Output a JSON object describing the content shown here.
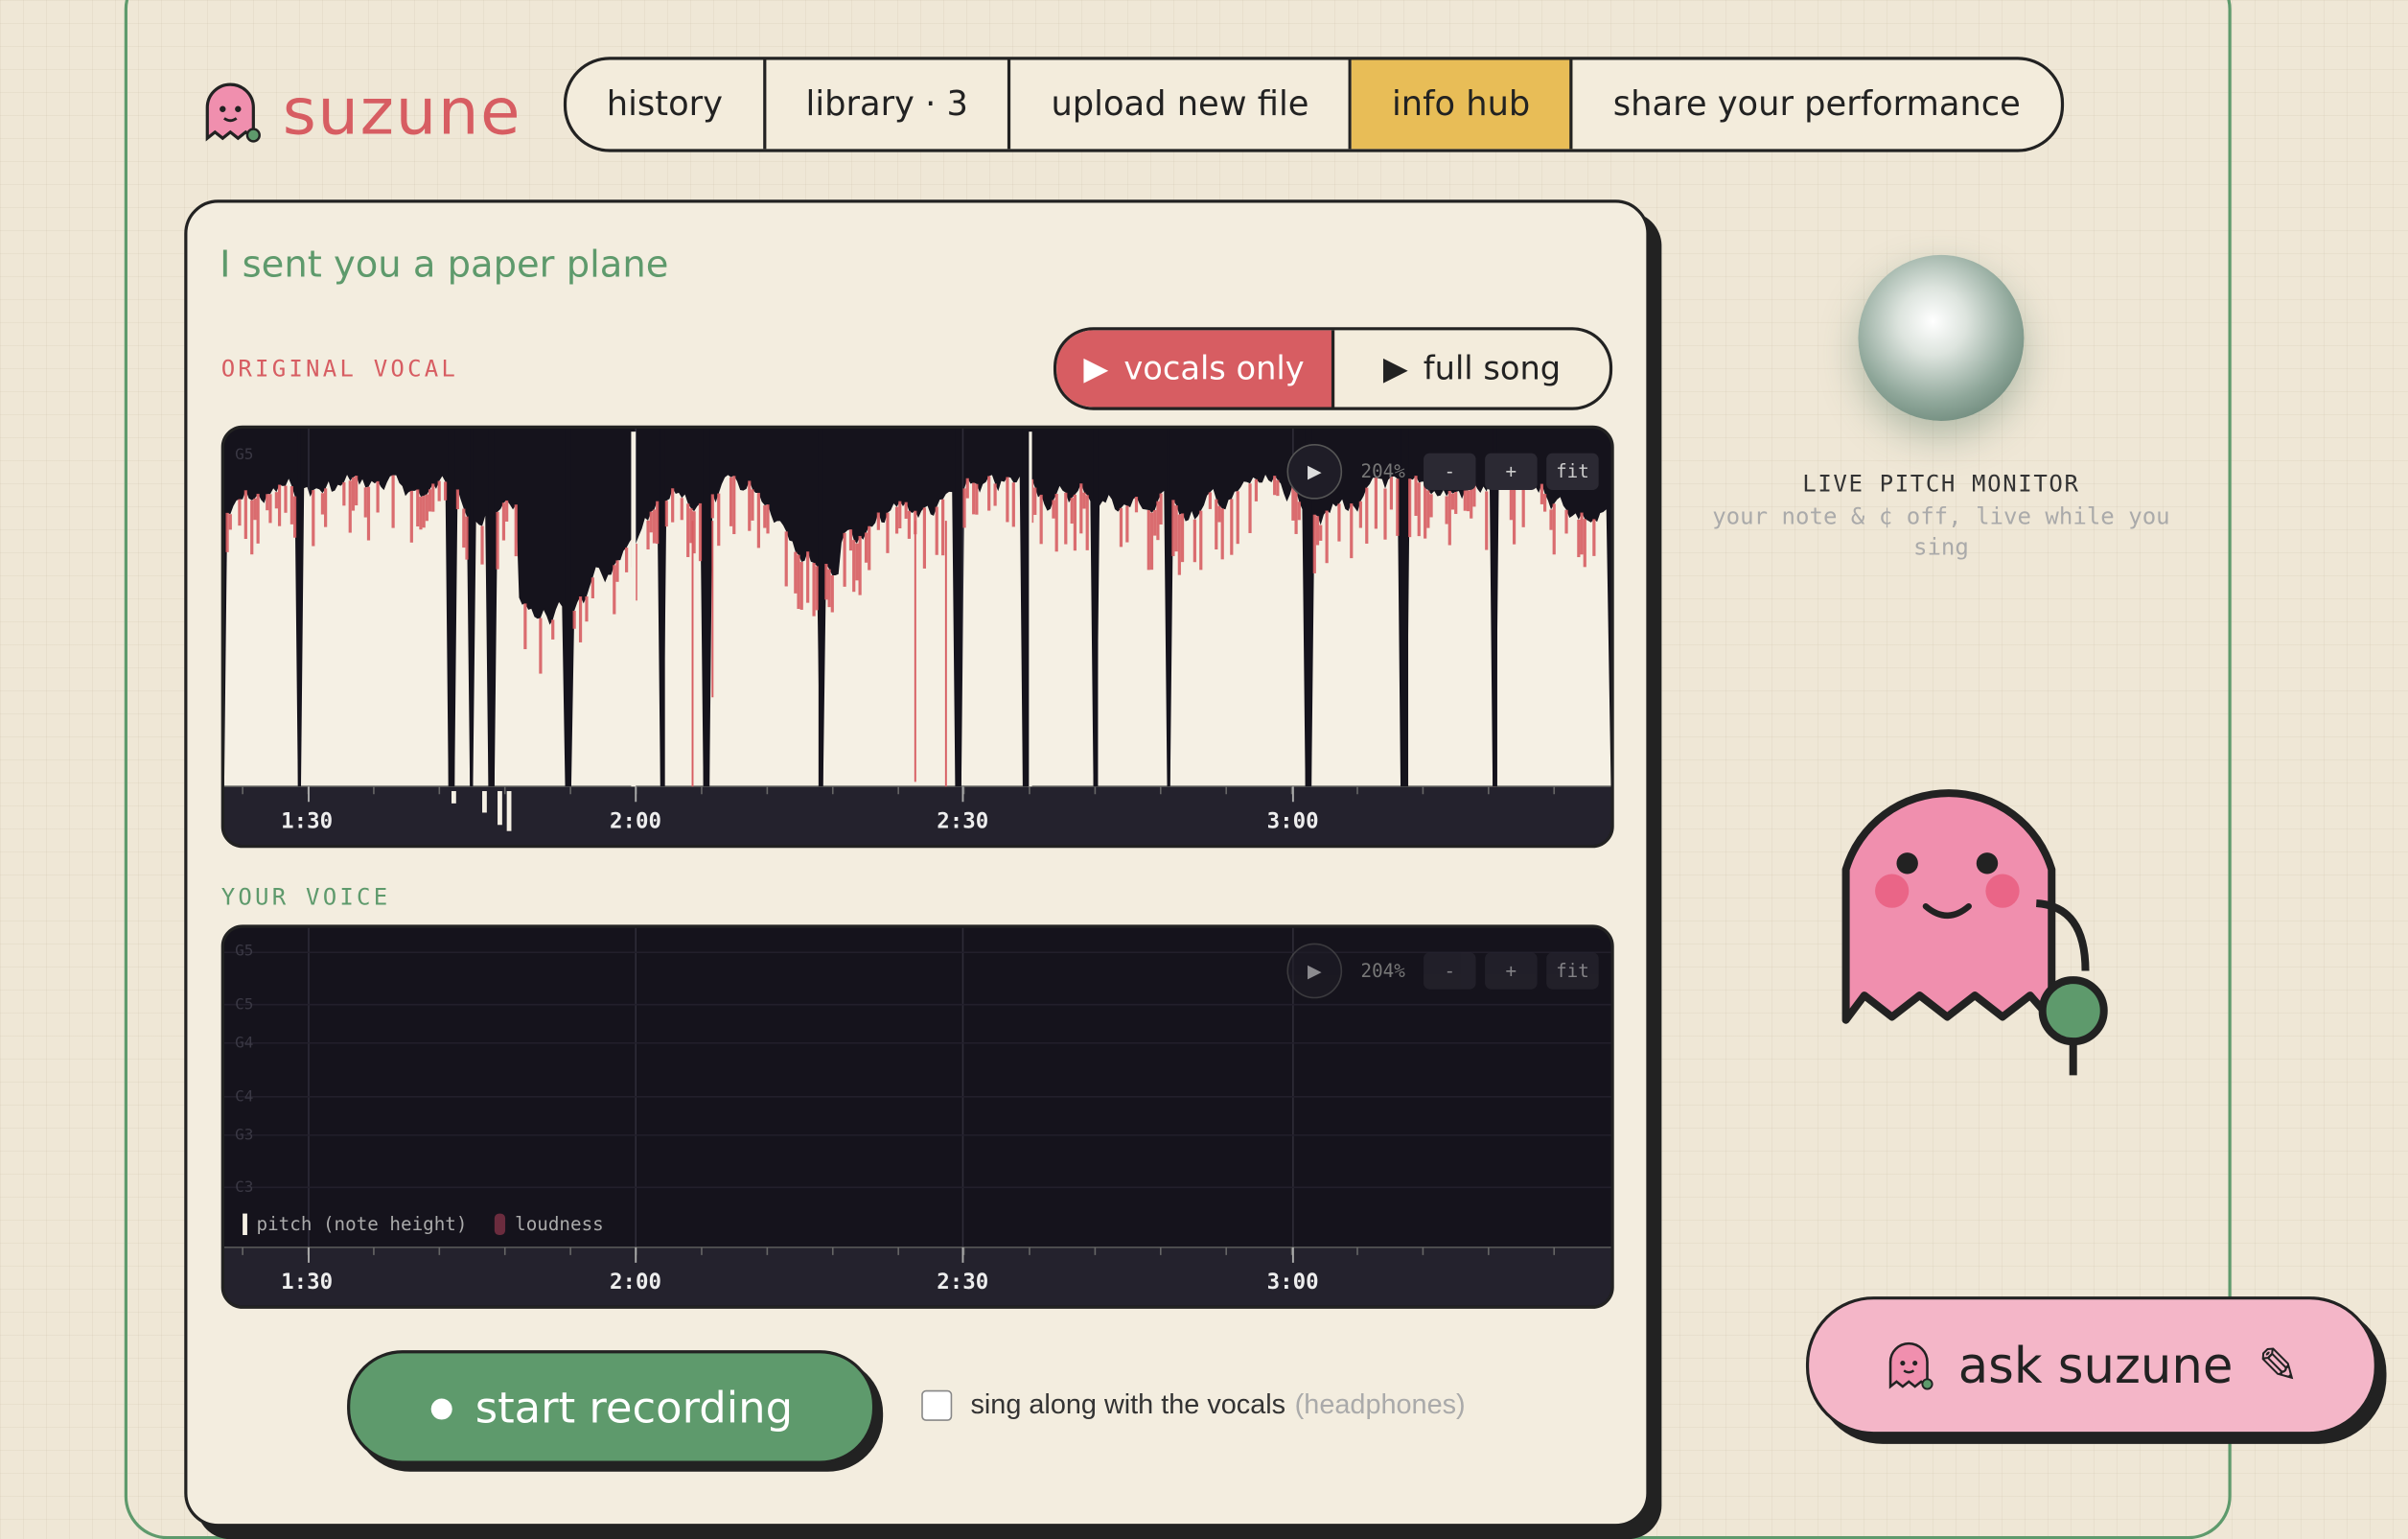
{
  "app": {
    "name": "suzune"
  },
  "nav": {
    "items": [
      {
        "label": "history"
      },
      {
        "label": "library · 3"
      },
      {
        "label": "upload new file"
      },
      {
        "label": "info hub"
      },
      {
        "label": "share your performance"
      }
    ]
  },
  "song": {
    "title": "I sent you a paper plane"
  },
  "original": {
    "label": "ORIGINAL VOCAL",
    "toggle": {
      "vocals_only": "vocals only",
      "full_song": "full song",
      "selected": "vocals only"
    },
    "zoom": "204%",
    "controls": {
      "play": "▶",
      "minus": "-",
      "plus": "+",
      "fit": "fit"
    },
    "note_labels": [
      "G5"
    ],
    "time_ticks": [
      "1:30",
      "2:00",
      "2:30",
      "3:00"
    ]
  },
  "your_voice": {
    "label": "YOUR VOICE",
    "zoom": "204%",
    "controls": {
      "play": "▶",
      "minus": "-",
      "plus": "+",
      "fit": "fit"
    },
    "note_labels": [
      "G5",
      "C5",
      "G4",
      "C4",
      "G3",
      "C3"
    ],
    "legend": {
      "pitch": "pitch (note height)",
      "loudness": "loudness"
    },
    "time_ticks": [
      "1:30",
      "2:00",
      "2:30",
      "3:00"
    ]
  },
  "record": {
    "label": "start recording",
    "dot": "●"
  },
  "sing_along": {
    "label": "sing along with the vocals",
    "hint": "(headphones)"
  },
  "monitor": {
    "title": "LIVE PITCH MONITOR",
    "subtitle": "your note & ¢ off, live while you sing"
  },
  "ask": {
    "label": "ask suzune",
    "icon": "✎"
  },
  "colors": {
    "accent_red": "#d75d62",
    "accent_green": "#5e9a6c",
    "accent_yellow": "#e8bd57",
    "pink": "#f4b6c8",
    "panel_bg": "#15131c"
  }
}
